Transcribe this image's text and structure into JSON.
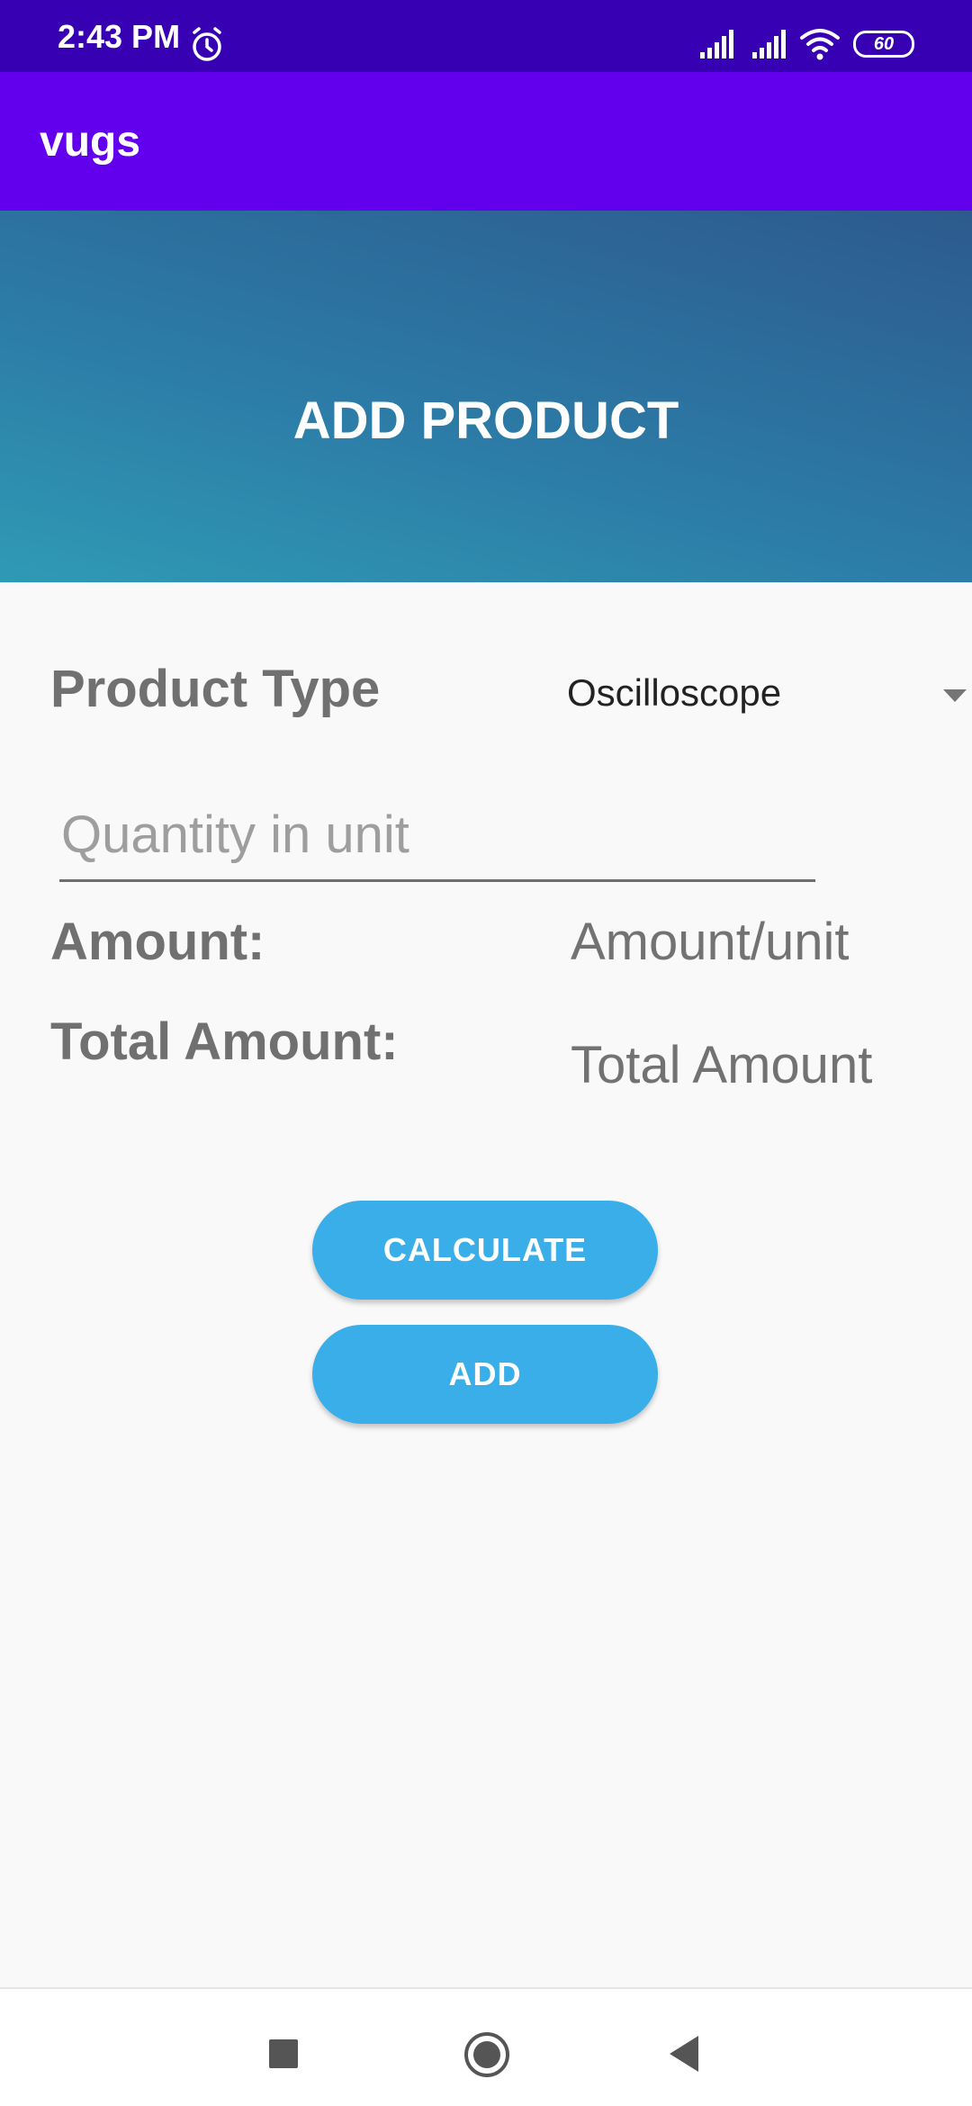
{
  "status_bar": {
    "time": "2:43 PM",
    "battery_level": "60",
    "icons": [
      "alarm-icon",
      "signal-icon",
      "signal-icon",
      "wifi-icon",
      "battery-icon"
    ]
  },
  "app_bar": {
    "title": "vugs"
  },
  "banner": {
    "title": "ADD PRODUCT"
  },
  "form": {
    "product_type_label": "Product Type",
    "product_type_value": "Oscilloscope",
    "quantity_placeholder": "Quantity in unit",
    "amount_label": "Amount:",
    "amount_value": "Amount/unit",
    "total_label": "Total Amount:",
    "total_value": "Total Amount"
  },
  "buttons": {
    "calculate": "CALCULATE",
    "add": "ADD"
  },
  "nav_bar": {
    "icons": [
      "recent-apps-icon",
      "home-icon",
      "back-icon"
    ]
  },
  "colors": {
    "status_bar": "#3700b3",
    "app_bar": "#6200ee",
    "button": "#3aaee8",
    "banner_start": "#2d5a8e",
    "banner_end": "#2f9ab5"
  }
}
